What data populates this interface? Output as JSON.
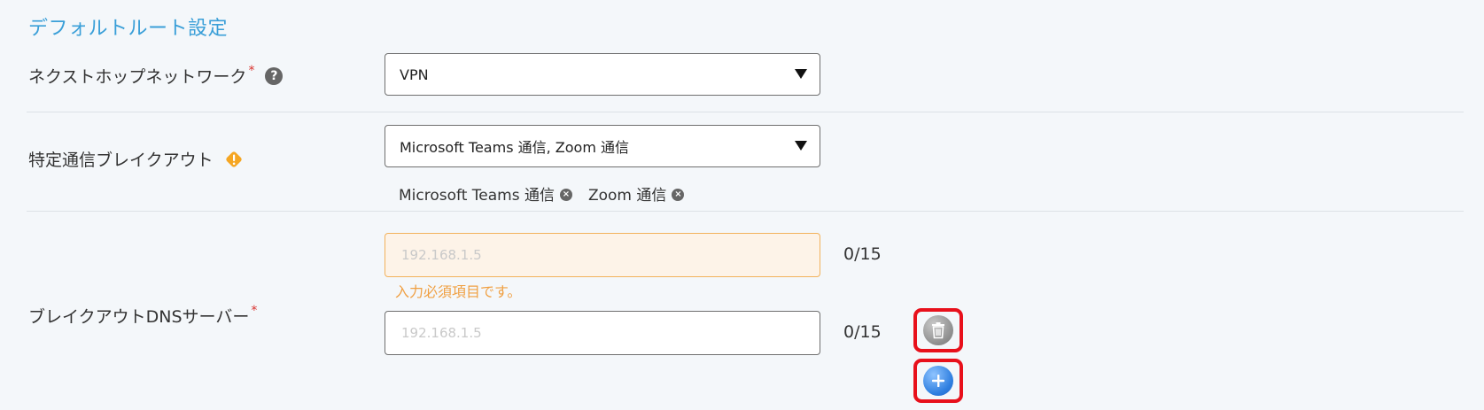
{
  "section": {
    "title": "デフォルトルート設定"
  },
  "next_hop": {
    "label": "ネクストホップネットワーク",
    "required_mark": "*",
    "help_icon": "question-circle-icon",
    "selected": "VPN"
  },
  "breakout": {
    "label": "特定通信ブレイクアウト",
    "warning_icon": "warning-diamond-icon",
    "selected": "Microsoft Teams 通信, Zoom 通信",
    "tags": [
      {
        "label": "Microsoft Teams 通信",
        "remove_icon": "close-circle-icon"
      },
      {
        "label": "Zoom 通信",
        "remove_icon": "close-circle-icon"
      }
    ]
  },
  "dns": {
    "label": "ブレイクアウトDNSサーバー",
    "required_mark": "*",
    "inputs": [
      {
        "value": "",
        "placeholder": "192.168.1.5",
        "counter": "0/15",
        "error": "入力必須項目です。"
      },
      {
        "value": "",
        "placeholder": "192.168.1.5",
        "counter": "0/15"
      }
    ],
    "delete_icon": "trash-icon",
    "add_icon": "plus-circle-icon"
  },
  "colors": {
    "title": "#3a9fd8",
    "required": "#d9302c",
    "warning": "#f5a623",
    "error_text": "#f0a043",
    "error_border": "#f2b25c",
    "highlight_frame": "#e8101b",
    "add_button": "#2f7fe0"
  }
}
